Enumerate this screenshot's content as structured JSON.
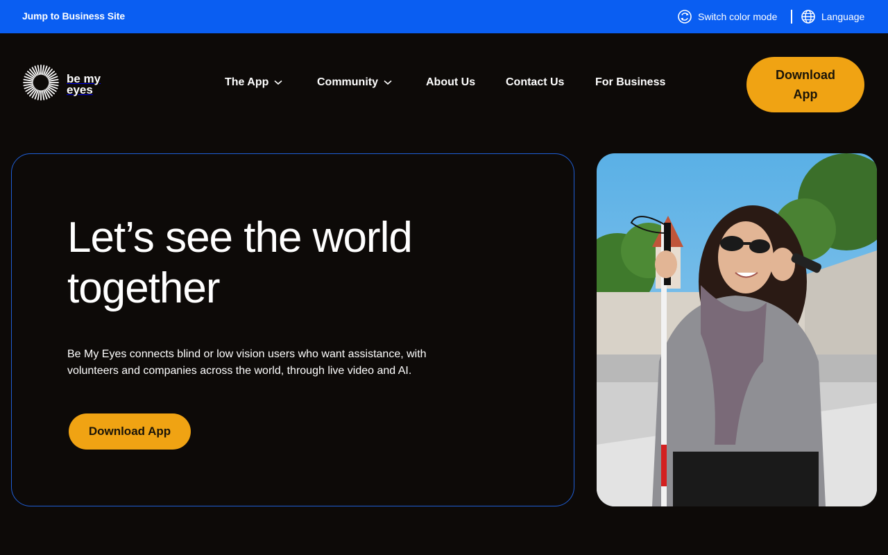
{
  "topbar": {
    "jump_link": "Jump to Business Site",
    "color_mode": "Switch color mode",
    "language": "Language",
    "color_mode_icon": "color-mode-icon",
    "language_icon": "globe-icon"
  },
  "logo": {
    "text": "be my eyes",
    "icon": "sunburst-logo-icon"
  },
  "nav": {
    "items": [
      {
        "label": "The App",
        "has_dropdown": true
      },
      {
        "label": "Community",
        "has_dropdown": true
      },
      {
        "label": "About Us",
        "has_dropdown": false
      },
      {
        "label": "Contact Us",
        "has_dropdown": false
      },
      {
        "label": "For Business",
        "has_dropdown": false
      }
    ],
    "download_label": "Download App"
  },
  "hero": {
    "title": "Let’s see the world together",
    "description": "Be My Eyes connects blind or low vision users who want assistance, with volunteers and companies across the world, through live video and AI.",
    "download_label": "Download App"
  },
  "colors": {
    "topbar": "#0a5ef2",
    "background": "#0d0a08",
    "accent": "#f0a313",
    "card_border": "#1f5fd8"
  }
}
